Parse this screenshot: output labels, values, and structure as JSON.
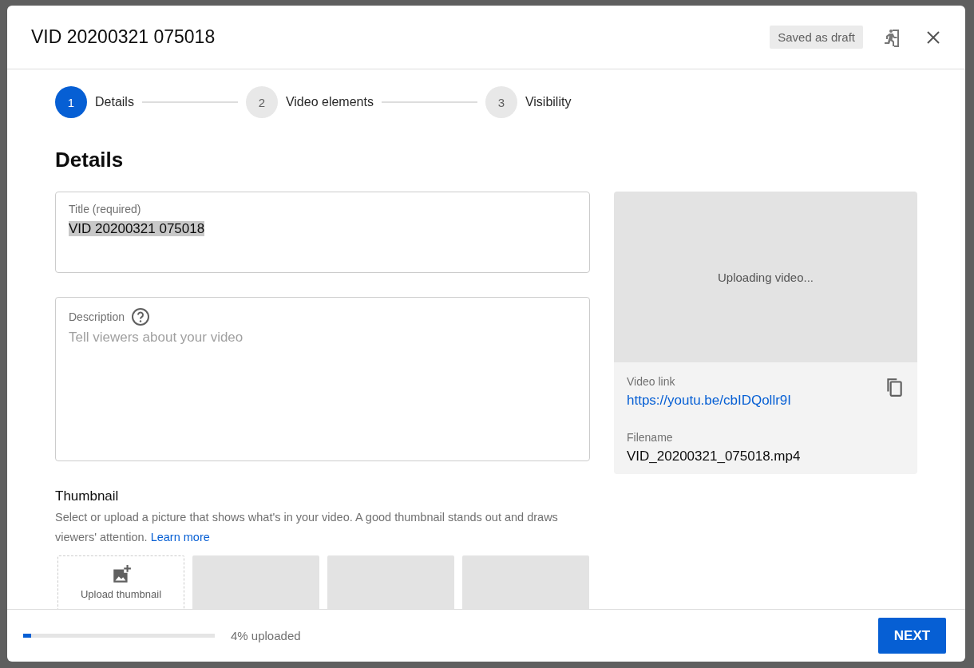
{
  "dialog": {
    "title": "VID 20200321 075018",
    "status_badge": "Saved as draft"
  },
  "steps": [
    {
      "number": "1",
      "label": "Details",
      "selected": true
    },
    {
      "number": "2",
      "label": "Video elements",
      "selected": false
    },
    {
      "number": "3",
      "label": "Visibility",
      "selected": false
    }
  ],
  "section_heading": "Details",
  "title_field": {
    "label": "Title (required)",
    "value": "VID 20200321 075018",
    "value_selected": true
  },
  "description_field": {
    "label": "Description",
    "placeholder": "Tell viewers about your video"
  },
  "preview": {
    "status": "Uploading video...",
    "link_label": "Video link",
    "link": "https://youtu.be/cbIDQollr9I",
    "filename_label": "Filename",
    "filename": "VID_20200321_075018.mp4"
  },
  "thumbnail": {
    "heading": "Thumbnail",
    "text": "Select or upload a picture that shows what's in your video. A good thumbnail stands out and draws viewers' attention.",
    "link": "Learn more",
    "slots": [
      {
        "kind": "upload",
        "label": "Upload thumbnail"
      },
      {
        "kind": "empty"
      },
      {
        "kind": "empty"
      },
      {
        "kind": "empty"
      }
    ]
  },
  "footer": {
    "progress": {
      "level": 0.04
    },
    "progress_text": "4% uploaded",
    "button": "NEXT"
  }
}
